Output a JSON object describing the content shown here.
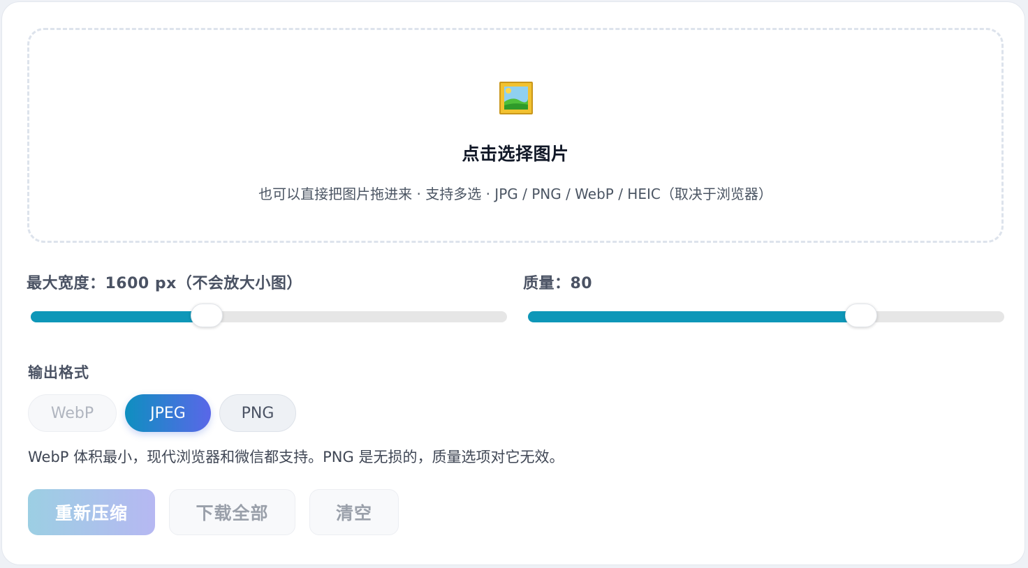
{
  "dropzone": {
    "icon": "framed-picture-icon",
    "title": "点击选择图片",
    "subtitle": "也可以直接把图片拖进来 · 支持多选 · JPG / PNG / WebP / HEIC（取决于浏览器）"
  },
  "width_slider": {
    "label": "最大宽度：1600 px（不会放大小图）",
    "fill_fraction": 0.37
  },
  "quality_slider": {
    "label": "质量：80",
    "fill_fraction": 0.7
  },
  "format": {
    "label": "输出格式",
    "options": [
      "WebP",
      "JPEG",
      "PNG"
    ],
    "selected": "JPEG",
    "hint": "WebP 体积最小，现代浏览器和微信都支持。PNG 是无损的，质量选项对它无效。"
  },
  "actions": {
    "recompress": "重新压缩",
    "download_all": "下载全部",
    "clear": "清空"
  },
  "colors": {
    "accent": "#0e97b8",
    "selected_gradient_start": "#0e8fc0",
    "selected_gradient_end": "#5a67e8"
  }
}
